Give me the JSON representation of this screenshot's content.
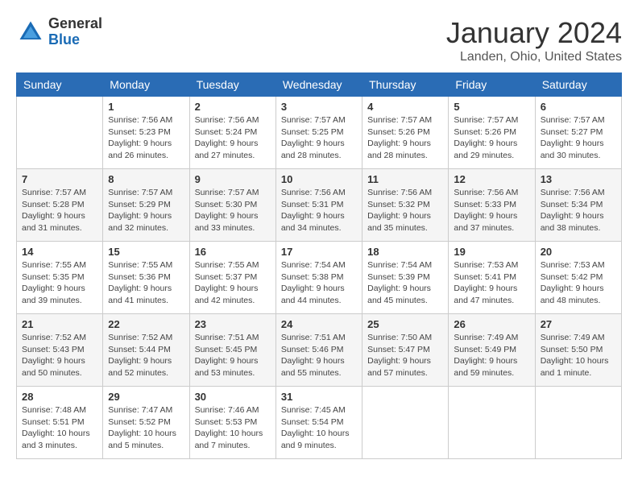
{
  "header": {
    "logo_general": "General",
    "logo_blue": "Blue",
    "month_title": "January 2024",
    "location": "Landen, Ohio, United States"
  },
  "weekdays": [
    "Sunday",
    "Monday",
    "Tuesday",
    "Wednesday",
    "Thursday",
    "Friday",
    "Saturday"
  ],
  "weeks": [
    [
      {
        "day": "",
        "sunrise": "",
        "sunset": "",
        "daylight": ""
      },
      {
        "day": "1",
        "sunrise": "Sunrise: 7:56 AM",
        "sunset": "Sunset: 5:23 PM",
        "daylight": "Daylight: 9 hours and 26 minutes."
      },
      {
        "day": "2",
        "sunrise": "Sunrise: 7:56 AM",
        "sunset": "Sunset: 5:24 PM",
        "daylight": "Daylight: 9 hours and 27 minutes."
      },
      {
        "day": "3",
        "sunrise": "Sunrise: 7:57 AM",
        "sunset": "Sunset: 5:25 PM",
        "daylight": "Daylight: 9 hours and 28 minutes."
      },
      {
        "day": "4",
        "sunrise": "Sunrise: 7:57 AM",
        "sunset": "Sunset: 5:26 PM",
        "daylight": "Daylight: 9 hours and 28 minutes."
      },
      {
        "day": "5",
        "sunrise": "Sunrise: 7:57 AM",
        "sunset": "Sunset: 5:26 PM",
        "daylight": "Daylight: 9 hours and 29 minutes."
      },
      {
        "day": "6",
        "sunrise": "Sunrise: 7:57 AM",
        "sunset": "Sunset: 5:27 PM",
        "daylight": "Daylight: 9 hours and 30 minutes."
      }
    ],
    [
      {
        "day": "7",
        "sunrise": "Sunrise: 7:57 AM",
        "sunset": "Sunset: 5:28 PM",
        "daylight": "Daylight: 9 hours and 31 minutes."
      },
      {
        "day": "8",
        "sunrise": "Sunrise: 7:57 AM",
        "sunset": "Sunset: 5:29 PM",
        "daylight": "Daylight: 9 hours and 32 minutes."
      },
      {
        "day": "9",
        "sunrise": "Sunrise: 7:57 AM",
        "sunset": "Sunset: 5:30 PM",
        "daylight": "Daylight: 9 hours and 33 minutes."
      },
      {
        "day": "10",
        "sunrise": "Sunrise: 7:56 AM",
        "sunset": "Sunset: 5:31 PM",
        "daylight": "Daylight: 9 hours and 34 minutes."
      },
      {
        "day": "11",
        "sunrise": "Sunrise: 7:56 AM",
        "sunset": "Sunset: 5:32 PM",
        "daylight": "Daylight: 9 hours and 35 minutes."
      },
      {
        "day": "12",
        "sunrise": "Sunrise: 7:56 AM",
        "sunset": "Sunset: 5:33 PM",
        "daylight": "Daylight: 9 hours and 37 minutes."
      },
      {
        "day": "13",
        "sunrise": "Sunrise: 7:56 AM",
        "sunset": "Sunset: 5:34 PM",
        "daylight": "Daylight: 9 hours and 38 minutes."
      }
    ],
    [
      {
        "day": "14",
        "sunrise": "Sunrise: 7:55 AM",
        "sunset": "Sunset: 5:35 PM",
        "daylight": "Daylight: 9 hours and 39 minutes."
      },
      {
        "day": "15",
        "sunrise": "Sunrise: 7:55 AM",
        "sunset": "Sunset: 5:36 PM",
        "daylight": "Daylight: 9 hours and 41 minutes."
      },
      {
        "day": "16",
        "sunrise": "Sunrise: 7:55 AM",
        "sunset": "Sunset: 5:37 PM",
        "daylight": "Daylight: 9 hours and 42 minutes."
      },
      {
        "day": "17",
        "sunrise": "Sunrise: 7:54 AM",
        "sunset": "Sunset: 5:38 PM",
        "daylight": "Daylight: 9 hours and 44 minutes."
      },
      {
        "day": "18",
        "sunrise": "Sunrise: 7:54 AM",
        "sunset": "Sunset: 5:39 PM",
        "daylight": "Daylight: 9 hours and 45 minutes."
      },
      {
        "day": "19",
        "sunrise": "Sunrise: 7:53 AM",
        "sunset": "Sunset: 5:41 PM",
        "daylight": "Daylight: 9 hours and 47 minutes."
      },
      {
        "day": "20",
        "sunrise": "Sunrise: 7:53 AM",
        "sunset": "Sunset: 5:42 PM",
        "daylight": "Daylight: 9 hours and 48 minutes."
      }
    ],
    [
      {
        "day": "21",
        "sunrise": "Sunrise: 7:52 AM",
        "sunset": "Sunset: 5:43 PM",
        "daylight": "Daylight: 9 hours and 50 minutes."
      },
      {
        "day": "22",
        "sunrise": "Sunrise: 7:52 AM",
        "sunset": "Sunset: 5:44 PM",
        "daylight": "Daylight: 9 hours and 52 minutes."
      },
      {
        "day": "23",
        "sunrise": "Sunrise: 7:51 AM",
        "sunset": "Sunset: 5:45 PM",
        "daylight": "Daylight: 9 hours and 53 minutes."
      },
      {
        "day": "24",
        "sunrise": "Sunrise: 7:51 AM",
        "sunset": "Sunset: 5:46 PM",
        "daylight": "Daylight: 9 hours and 55 minutes."
      },
      {
        "day": "25",
        "sunrise": "Sunrise: 7:50 AM",
        "sunset": "Sunset: 5:47 PM",
        "daylight": "Daylight: 9 hours and 57 minutes."
      },
      {
        "day": "26",
        "sunrise": "Sunrise: 7:49 AM",
        "sunset": "Sunset: 5:49 PM",
        "daylight": "Daylight: 9 hours and 59 minutes."
      },
      {
        "day": "27",
        "sunrise": "Sunrise: 7:49 AM",
        "sunset": "Sunset: 5:50 PM",
        "daylight": "Daylight: 10 hours and 1 minute."
      }
    ],
    [
      {
        "day": "28",
        "sunrise": "Sunrise: 7:48 AM",
        "sunset": "Sunset: 5:51 PM",
        "daylight": "Daylight: 10 hours and 3 minutes."
      },
      {
        "day": "29",
        "sunrise": "Sunrise: 7:47 AM",
        "sunset": "Sunset: 5:52 PM",
        "daylight": "Daylight: 10 hours and 5 minutes."
      },
      {
        "day": "30",
        "sunrise": "Sunrise: 7:46 AM",
        "sunset": "Sunset: 5:53 PM",
        "daylight": "Daylight: 10 hours and 7 minutes."
      },
      {
        "day": "31",
        "sunrise": "Sunrise: 7:45 AM",
        "sunset": "Sunset: 5:54 PM",
        "daylight": "Daylight: 10 hours and 9 minutes."
      },
      {
        "day": "",
        "sunrise": "",
        "sunset": "",
        "daylight": ""
      },
      {
        "day": "",
        "sunrise": "",
        "sunset": "",
        "daylight": ""
      },
      {
        "day": "",
        "sunrise": "",
        "sunset": "",
        "daylight": ""
      }
    ]
  ]
}
